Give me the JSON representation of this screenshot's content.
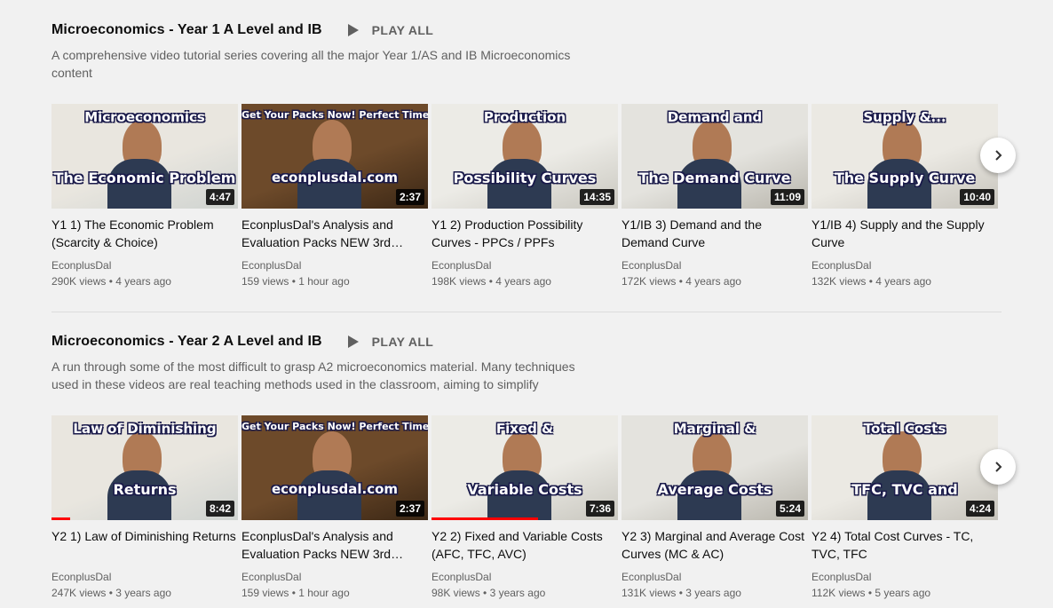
{
  "icons": {
    "play": "play-icon",
    "next": "chevron-right-icon"
  },
  "colors": {
    "progress": "#ff0000",
    "secondary_text": "#606060",
    "background": "#f1f1f1"
  },
  "shelves": [
    {
      "title": "Microeconomics - Year 1 A Level and IB",
      "play_all": "PLAY ALL",
      "description": "A comprehensive video tutorial series covering all the major Year 1/AS and IB Microeconomics content",
      "videos": [
        {
          "title": "Y1 1) The Economic Problem (Scarcity & Choice)",
          "thumb_top": "Microeconomics",
          "thumb_bottom": "The Economic Problem",
          "duration": "4:47",
          "channel": "EconplusDal",
          "views": "290K views",
          "age": "4 years ago",
          "watched_pct": 0
        },
        {
          "title": "EconplusDal's Analysis and Evaluation Packs NEW 3rd…",
          "thumb_top": "Get Your Packs Now!   Perfect Time To Use Them",
          "thumb_bottom": "econplusdal.com",
          "duration": "2:37",
          "channel": "EconplusDal",
          "views": "159 views",
          "age": "1 hour ago",
          "watched_pct": 0
        },
        {
          "title": "Y1 2) Production Possibility Curves - PPCs / PPFs",
          "thumb_top": "Production",
          "thumb_bottom": "Possibility Curves",
          "duration": "14:35",
          "channel": "EconplusDal",
          "views": "198K views",
          "age": "4 years ago",
          "watched_pct": 0
        },
        {
          "title": "Y1/IB 3) Demand and the Demand Curve",
          "thumb_top": "Demand and",
          "thumb_bottom": "The Demand Curve",
          "duration": "11:09",
          "channel": "EconplusDal",
          "views": "172K views",
          "age": "4 years ago",
          "watched_pct": 0
        },
        {
          "title": "Y1/IB 4) Supply and the Supply Curve",
          "thumb_top": "Supply &...",
          "thumb_bottom": "The Supply Curve",
          "duration": "10:40",
          "channel": "EconplusDal",
          "views": "132K views",
          "age": "4 years ago",
          "watched_pct": 0
        }
      ]
    },
    {
      "title": "Microeconomics - Year 2 A Level and IB",
      "play_all": "PLAY ALL",
      "description": "A run through some of the most difficult to grasp A2 microeconomics material. Many techniques used in these videos are real teaching methods used in the classroom, aiming to simplify content…",
      "videos": [
        {
          "title": "Y2 1) Law of Diminishing Returns",
          "thumb_top": "Law of Diminishing",
          "thumb_bottom": "Returns",
          "duration": "8:42",
          "channel": "EconplusDal",
          "views": "247K views",
          "age": "3 years ago",
          "watched_pct": 10
        },
        {
          "title": "EconplusDal's Analysis and Evaluation Packs NEW 3rd…",
          "thumb_top": "Get Your Packs Now!   Perfect Time To Use Them",
          "thumb_bottom": "econplusdal.com",
          "duration": "2:37",
          "channel": "EconplusDal",
          "views": "159 views",
          "age": "1 hour ago",
          "watched_pct": 0
        },
        {
          "title": "Y2 2) Fixed and Variable Costs (AFC, TFC, AVC)",
          "thumb_top": "Fixed &",
          "thumb_bottom": "Variable Costs",
          "duration": "7:36",
          "channel": "EconplusDal",
          "views": "98K views",
          "age": "3 years ago",
          "watched_pct": 57
        },
        {
          "title": "Y2 3) Marginal and Average Cost Curves (MC & AC)",
          "thumb_top": "Marginal &",
          "thumb_bottom": "Average Costs",
          "duration": "5:24",
          "channel": "EconplusDal",
          "views": "131K views",
          "age": "3 years ago",
          "watched_pct": 0
        },
        {
          "title": "Y2 4) Total Cost Curves - TC, TVC, TFC",
          "thumb_top": "Total Costs",
          "thumb_bottom": "TFC, TVC and",
          "duration": "4:24",
          "channel": "EconplusDal",
          "views": "112K views",
          "age": "5 years ago",
          "watched_pct": 0
        }
      ]
    }
  ]
}
